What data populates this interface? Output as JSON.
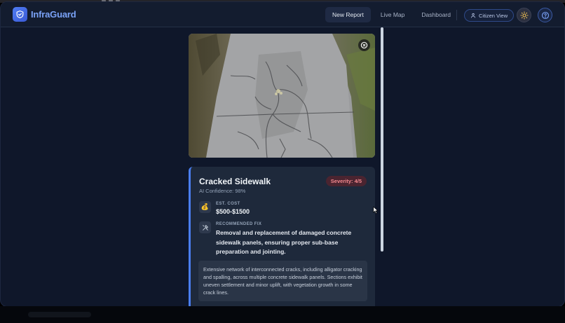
{
  "app": {
    "name": "InfraGuard",
    "brand_color": "#4f7cf2"
  },
  "nav": {
    "links": [
      {
        "label": "New Report",
        "active": true
      },
      {
        "label": "Live Map",
        "active": false
      },
      {
        "label": "Dashboard",
        "active": false
      }
    ],
    "citizen_view": "Citizen View",
    "theme_icon": "sun-icon",
    "help_icon": "help-icon"
  },
  "report": {
    "photo_alt": "cracked-sidewalk-photo",
    "title": "Cracked Sidewalk",
    "confidence": "AI Confidence: 98%",
    "severity": "Severity: 4/5",
    "cost_label": "EST. COST",
    "cost_value": "$500-$1500",
    "fix_label": "RECOMMENDED FIX",
    "fix_value": "Removal and replacement of damaged concrete sidewalk panels, ensuring proper sub-base preparation and jointing.",
    "description": "Extensive network of interconnected cracks, including alligator cracking and spalling, across multiple concrete sidewalk panels. Sections exhibit uneven settlement and minor uplift, with vegetation growth in some crack lines."
  },
  "colors": {
    "background": "#0f172a",
    "card": "#1e293b",
    "accent": "#4a7ef0",
    "severity_bg": "#4a2430",
    "severity_text": "#f3888e"
  }
}
